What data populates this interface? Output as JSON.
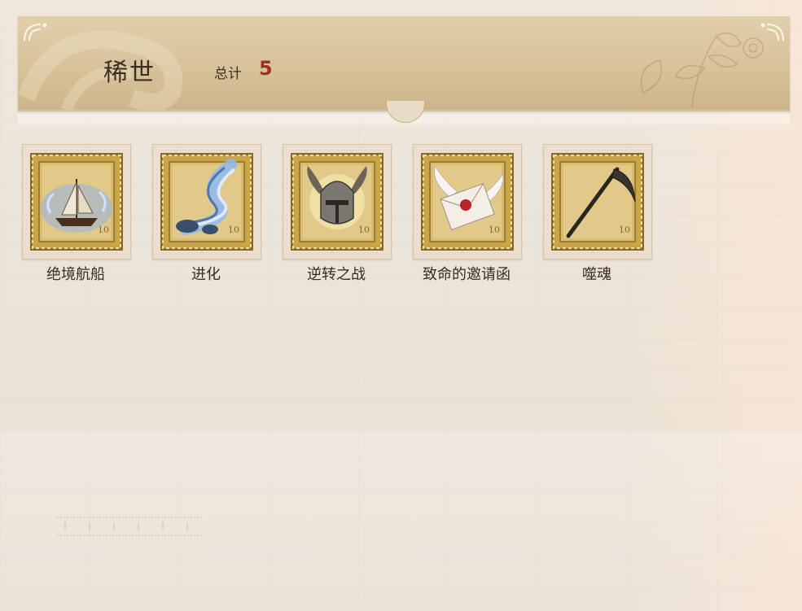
{
  "header": {
    "title": "稀世",
    "total_label": "总计",
    "total_value": "5"
  },
  "stamps": [
    {
      "label": "绝境航船",
      "icon": "sailing-ship-icon"
    },
    {
      "label": "进化",
      "icon": "dna-helix-icon"
    },
    {
      "label": "逆转之战",
      "icon": "winged-helmet-icon"
    },
    {
      "label": "致命的邀请函",
      "icon": "winged-letter-icon"
    },
    {
      "label": "噬魂",
      "icon": "scythe-icon"
    }
  ],
  "colors": {
    "stamp_gold": "#c9a54a",
    "stamp_dark": "#8a6a28",
    "total_red": "#9a3326",
    "text_brown": "#3b2e22"
  }
}
